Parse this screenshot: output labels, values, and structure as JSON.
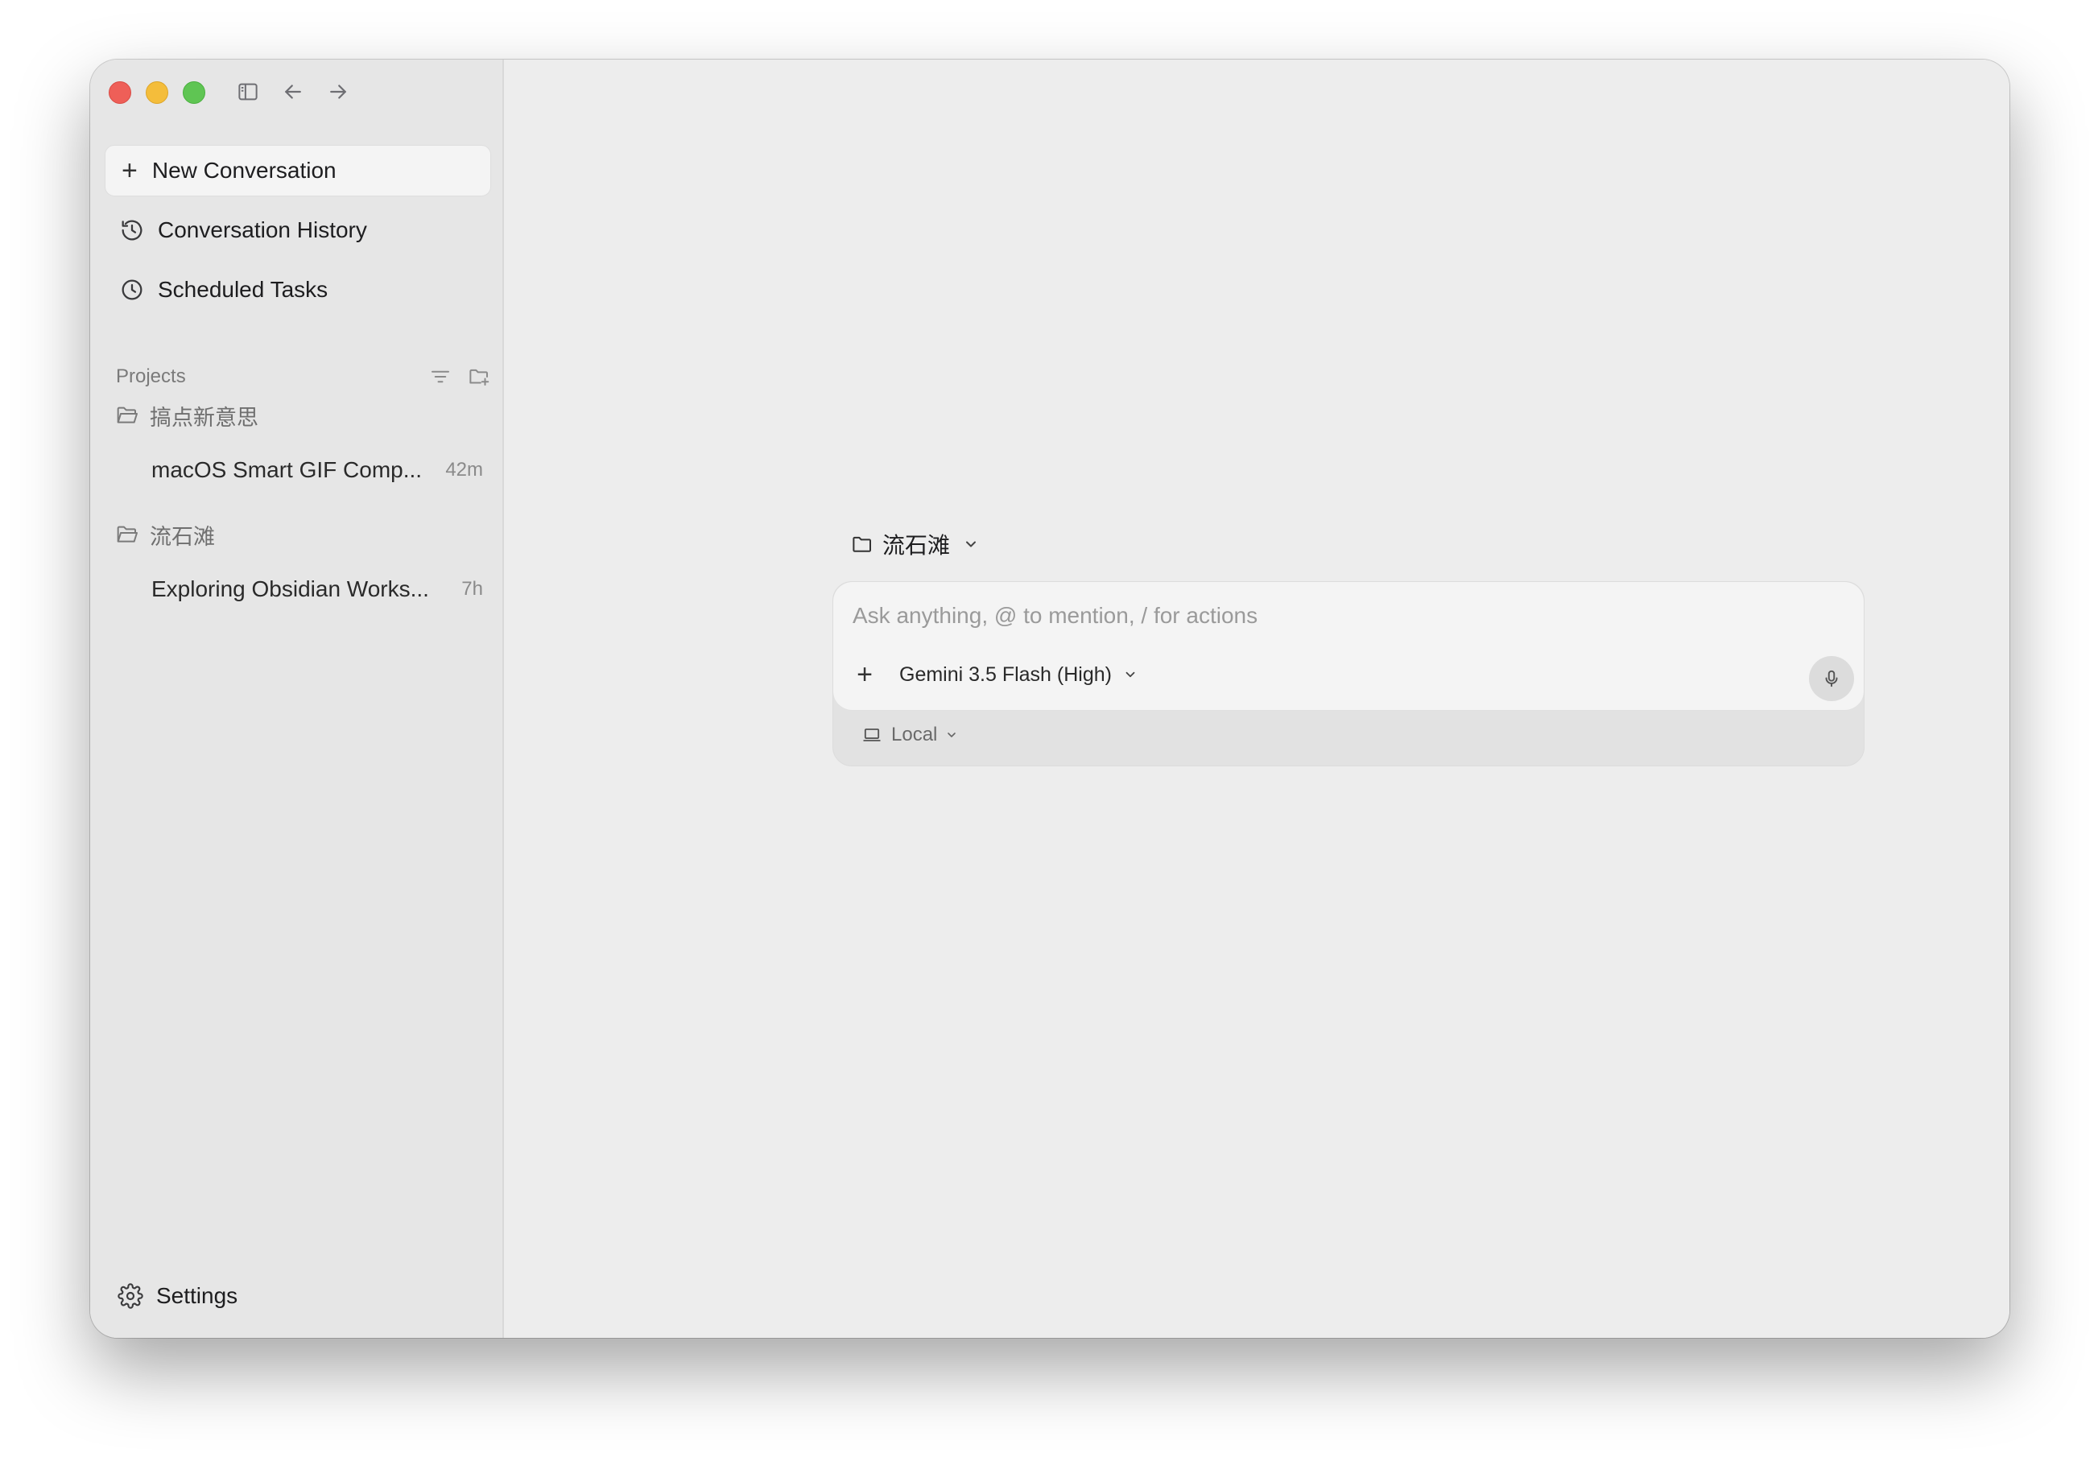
{
  "window": {
    "toolbar": {
      "sidebar_toggle_icon": "sidebar-icon",
      "back_icon": "arrow-left-icon",
      "forward_icon": "arrow-right-icon"
    }
  },
  "sidebar": {
    "new_conversation": "New Conversation",
    "nav": [
      {
        "label": "Conversation History",
        "icon": "history-icon"
      },
      {
        "label": "Scheduled Tasks",
        "icon": "clock-icon"
      }
    ],
    "projects_label": "Projects",
    "projects": [
      {
        "name": "搞点新意思",
        "conversations": [
          {
            "title": "macOS Smart GIF Comp...",
            "age": "42m"
          }
        ]
      },
      {
        "name": "流石滩",
        "conversations": [
          {
            "title": "Exploring Obsidian Works...",
            "age": "7h"
          }
        ]
      }
    ],
    "settings": "Settings"
  },
  "main": {
    "workspace": "流石滩",
    "composer": {
      "placeholder": "Ask anything, @ to mention, / for actions",
      "value": "",
      "model": "Gemini 3.5 Flash (High)",
      "environment": "Local"
    }
  }
}
